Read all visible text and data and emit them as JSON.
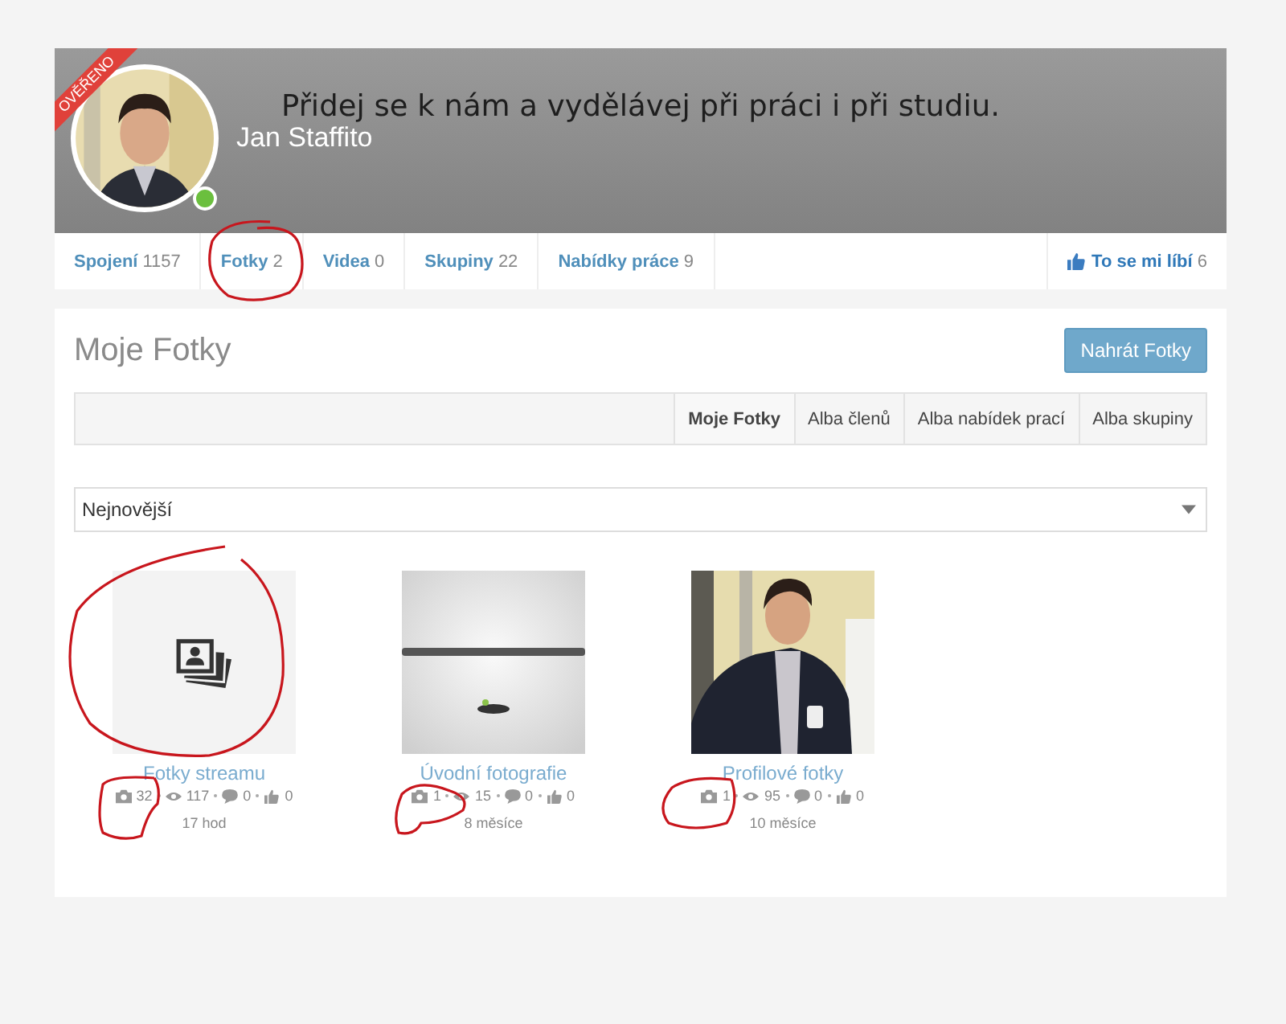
{
  "profile": {
    "verified_badge": "OVĚŘENO",
    "online": true,
    "name": "Jan Staffito",
    "cover_text": "Přidej se k nám a vydělávej při práci i při studiu."
  },
  "profile_tabs": [
    {
      "label": "Spojení",
      "count": "1157"
    },
    {
      "label": "Fotky",
      "count": "2"
    },
    {
      "label": "Videa",
      "count": "0"
    },
    {
      "label": "Skupiny",
      "count": "22"
    },
    {
      "label": "Nabídky práce",
      "count": "9"
    }
  ],
  "like": {
    "label": "To se mi líbí",
    "count": "6"
  },
  "section": {
    "title": "Moje Fotky",
    "upload_button": "Nahrát Fotky"
  },
  "album_tabs": [
    {
      "label": "Moje Fotky",
      "selected": true
    },
    {
      "label": "Alba členů",
      "selected": false
    },
    {
      "label": "Alba nabídek prací",
      "selected": false
    },
    {
      "label": "Alba skupiny",
      "selected": false
    }
  ],
  "sort": {
    "value": "Nejnovější"
  },
  "albums": [
    {
      "kind": "placeholder",
      "title": "Fotky streamu",
      "photos": "32",
      "views": "117",
      "comments": "0",
      "likes": "0",
      "age": "17 hod"
    },
    {
      "kind": "banner",
      "title": "Úvodní fotografie",
      "photos": "1",
      "views": "15",
      "comments": "0",
      "likes": "0",
      "age": "8 měsíce"
    },
    {
      "kind": "portrait",
      "title": "Profilové fotky",
      "photos": "1",
      "views": "95",
      "comments": "0",
      "likes": "0",
      "age": "10 měsíce"
    }
  ]
}
